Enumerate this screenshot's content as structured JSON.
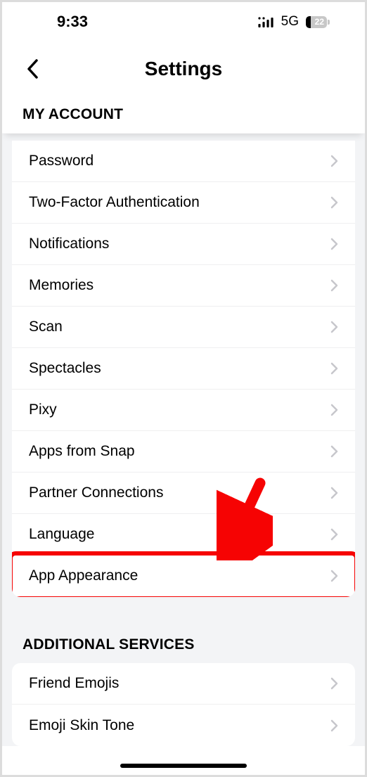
{
  "status_bar": {
    "time": "9:33",
    "network_label": "5G",
    "battery_percent": "22"
  },
  "header": {
    "title": "Settings"
  },
  "sections": {
    "my_account": {
      "title": "MY ACCOUNT",
      "items": [
        {
          "label": "Password"
        },
        {
          "label": "Two-Factor Authentication"
        },
        {
          "label": "Notifications"
        },
        {
          "label": "Memories"
        },
        {
          "label": "Scan"
        },
        {
          "label": "Spectacles"
        },
        {
          "label": "Pixy"
        },
        {
          "label": "Apps from Snap"
        },
        {
          "label": "Partner Connections"
        },
        {
          "label": "Language"
        },
        {
          "label": "App Appearance"
        }
      ]
    },
    "additional_services": {
      "title": "ADDITIONAL SERVICES",
      "items": [
        {
          "label": "Friend Emojis"
        },
        {
          "label": "Emoji Skin Tone"
        }
      ]
    }
  },
  "annotation": {
    "highlight_target": "app-appearance",
    "arrow_color": "#f60303"
  }
}
